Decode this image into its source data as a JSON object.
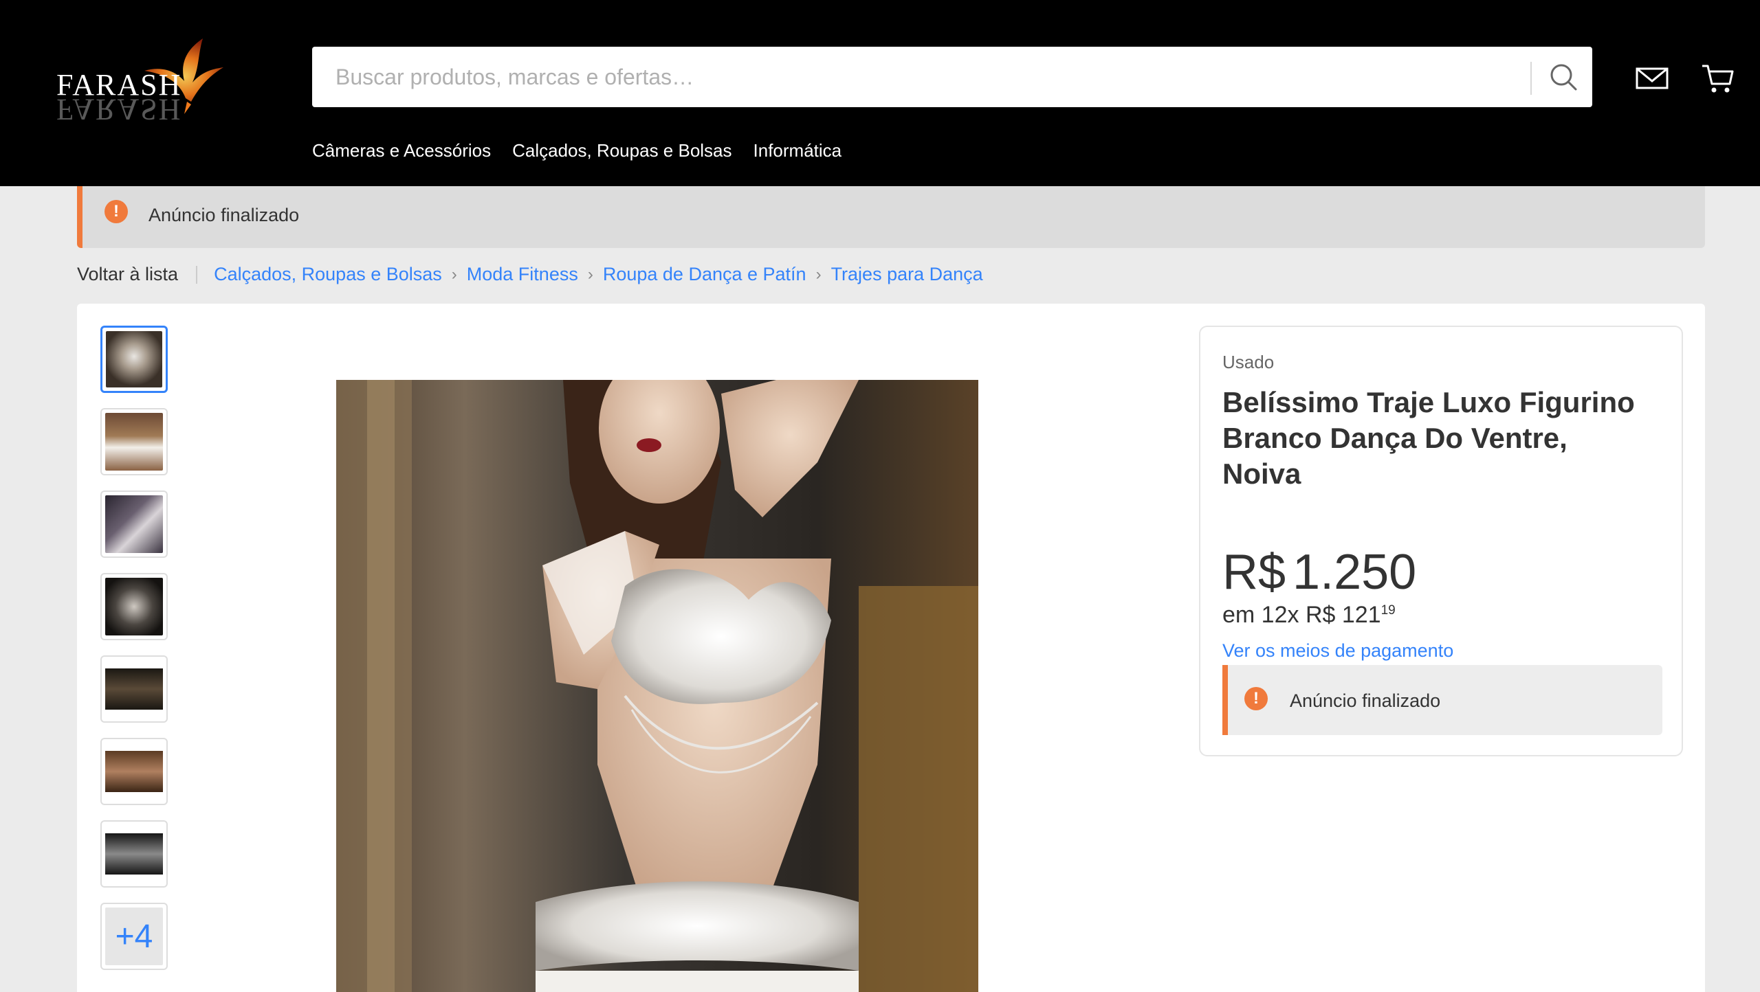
{
  "brand": {
    "name": "FARASH"
  },
  "search": {
    "placeholder": "Buscar produtos, marcas e ofertas…",
    "value": ""
  },
  "header": {
    "icons": [
      "mail-icon",
      "cart-icon",
      "search-icon"
    ],
    "nav": [
      {
        "label": "Câmeras e Acessórios"
      },
      {
        "label": "Calçados, Roupas e Bolsas"
      },
      {
        "label": "Informática"
      }
    ]
  },
  "status_banner": {
    "text": "Anúncio finalizado",
    "accent": "#f07a3c"
  },
  "breadcrumb": {
    "back": "Voltar à lista",
    "items": [
      {
        "label": "Calçados, Roupas e Bolsas"
      },
      {
        "label": "Moda Fitness"
      },
      {
        "label": "Roupa de Dança e Patín"
      },
      {
        "label": "Trajes para Dança"
      }
    ]
  },
  "gallery": {
    "thumbnail_count_visible": 7,
    "more_label": "+4",
    "selected_index": 0
  },
  "product": {
    "condition": "Usado",
    "title": "Belíssimo Traje Luxo Figurino Branco Dança Do Ventre, Noiva",
    "price_currency": "R$",
    "price_value": "1.250",
    "installments_prefix": "em 12x R$ 121",
    "installments_cents": "19",
    "payment_link": "Ver os meios de pagamento",
    "status_text": "Anúncio finalizado"
  },
  "colors": {
    "link": "#3483fa",
    "warning": "#f07a3c",
    "header_bg": "#000000"
  }
}
